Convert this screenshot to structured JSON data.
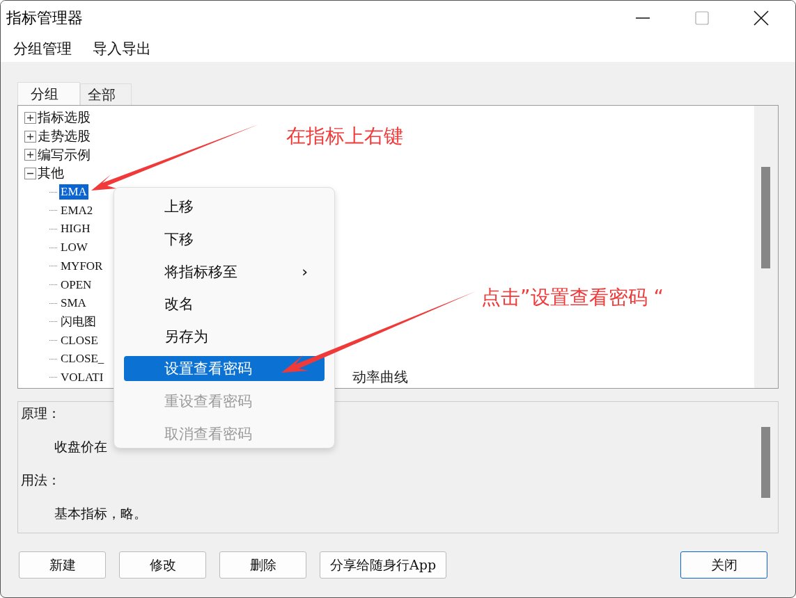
{
  "window": {
    "title": "指标管理器"
  },
  "menu_bar": [
    "分组管理",
    "导入导出"
  ],
  "tabs": [
    {
      "label": "分组",
      "selected": true
    },
    {
      "label": "全部",
      "selected": false
    }
  ],
  "tree": [
    {
      "label": "指标选股",
      "expanded": false
    },
    {
      "label": "走势选股",
      "expanded": false
    },
    {
      "label": "编写示例",
      "expanded": false
    },
    {
      "label": "其他",
      "expanded": true,
      "children": [
        {
          "label": "EMA",
          "selected": true
        },
        {
          "label": "EMA2",
          "selected": false
        },
        {
          "label": "HIGH",
          "selected": false
        },
        {
          "label": "LOW",
          "selected": false
        },
        {
          "label": "MYFOR",
          "selected": false
        },
        {
          "label": "OPEN",
          "selected": false
        },
        {
          "label": "SMA",
          "selected": false
        },
        {
          "label": "闪电图",
          "selected": false
        },
        {
          "label": "CLOSE",
          "selected": false
        },
        {
          "label": "CLOSE_",
          "selected": false
        },
        {
          "label": "VOLATI",
          "selected": false,
          "tail": "动率曲线"
        }
      ]
    }
  ],
  "description": [
    {
      "kind": "heading",
      "text": "原理："
    },
    {
      "kind": "body",
      "text": "收盘价在"
    },
    {
      "kind": "heading",
      "text": "用法："
    },
    {
      "kind": "body",
      "text": "基本指标，略。"
    }
  ],
  "buttons": [
    {
      "label": "新建",
      "default": false
    },
    {
      "label": "修改",
      "default": false
    },
    {
      "label": "删除",
      "default": false
    },
    {
      "label": "分享给随身行App",
      "default": false
    },
    {
      "label": "关闭",
      "default": true
    }
  ],
  "context_menu": [
    {
      "label": "上移",
      "selected": false,
      "disabled": false
    },
    {
      "label": "下移",
      "selected": false,
      "disabled": false
    },
    {
      "label": "将指标移至",
      "selected": false,
      "disabled": false,
      "arrow": "›"
    },
    {
      "label": "改名",
      "selected": false,
      "disabled": false
    },
    {
      "label": "另存为",
      "selected": false,
      "disabled": false
    },
    {
      "label": "设置查看密码",
      "selected": true,
      "disabled": false
    },
    {
      "label": "重设查看密码",
      "selected": false,
      "disabled": true
    },
    {
      "label": "取消查看密码",
      "selected": false,
      "disabled": true
    }
  ],
  "annotations": [
    {
      "text": "在指标上右键"
    },
    {
      "text": "点击”设置查看密码 “"
    }
  ]
}
